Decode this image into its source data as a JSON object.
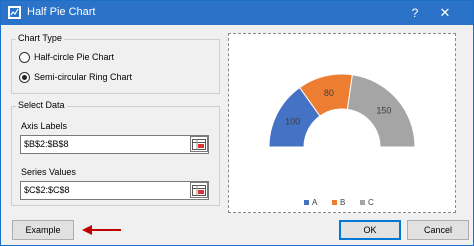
{
  "window": {
    "title": "Half Pie Chart",
    "help": "?",
    "close": "✕"
  },
  "chart_type": {
    "legend": "Chart Type",
    "options": [
      "Half-circle Pie Chart",
      "Semi-circular Ring Chart"
    ],
    "selected_index": 1
  },
  "select_data": {
    "legend": "Select Data",
    "axis_labels": {
      "label": "Axis Labels",
      "value": "$B$2:$B$8"
    },
    "series_values": {
      "label": "Series Values",
      "value": "$C$2:$C$8"
    }
  },
  "chart_data": {
    "type": "pie",
    "variant": "semi-circular ring",
    "categories": [
      "A",
      "B",
      "C"
    ],
    "values": [
      100,
      80,
      150
    ],
    "colors": [
      "#4472c4",
      "#ed7d31",
      "#a5a5a5"
    ],
    "legend_position": "bottom"
  },
  "buttons": {
    "example": "Example",
    "ok": "OK",
    "cancel": "Cancel"
  },
  "colors": {
    "titlebar": "#2b73c9",
    "arrow": "#c00000"
  }
}
